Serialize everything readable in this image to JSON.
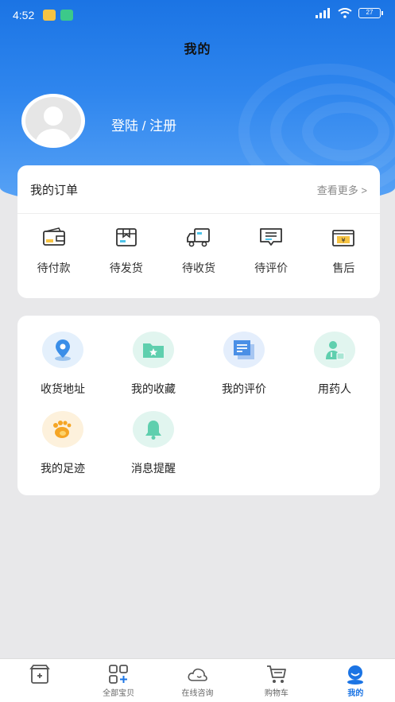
{
  "status_bar": {
    "time": "4:52",
    "battery": "27"
  },
  "header": {
    "title": "我的"
  },
  "profile": {
    "login_text": "登陆 / 注册"
  },
  "orders": {
    "title": "我的订单",
    "more": "查看更多 >",
    "items": [
      {
        "label": "待付款",
        "icon": "wallet-icon"
      },
      {
        "label": "待发货",
        "icon": "package-icon"
      },
      {
        "label": "待收货",
        "icon": "truck-icon"
      },
      {
        "label": "待评价",
        "icon": "comment-icon"
      },
      {
        "label": "售后",
        "icon": "refund-icon"
      }
    ]
  },
  "tools": {
    "items": [
      {
        "label": "收货地址",
        "icon": "location-icon"
      },
      {
        "label": "我的收藏",
        "icon": "favorite-folder-icon"
      },
      {
        "label": "我的评价",
        "icon": "review-icon"
      },
      {
        "label": "用药人",
        "icon": "patient-icon"
      },
      {
        "label": "我的足迹",
        "icon": "footprint-icon"
      },
      {
        "label": "消息提醒",
        "icon": "bell-icon"
      }
    ]
  },
  "tabbar": {
    "active": "我的",
    "items": [
      {
        "label": "",
        "icon": "home-store-icon"
      },
      {
        "label": "全部宝贝",
        "icon": "grid-icon"
      },
      {
        "label": "在线咨询",
        "icon": "chat-cloud-icon"
      },
      {
        "label": "购物车",
        "icon": "cart-icon"
      },
      {
        "label": "我的",
        "icon": "profile-icon"
      }
    ]
  },
  "colors": {
    "brand": "#1b74e4",
    "background": "#e8e8ea"
  }
}
